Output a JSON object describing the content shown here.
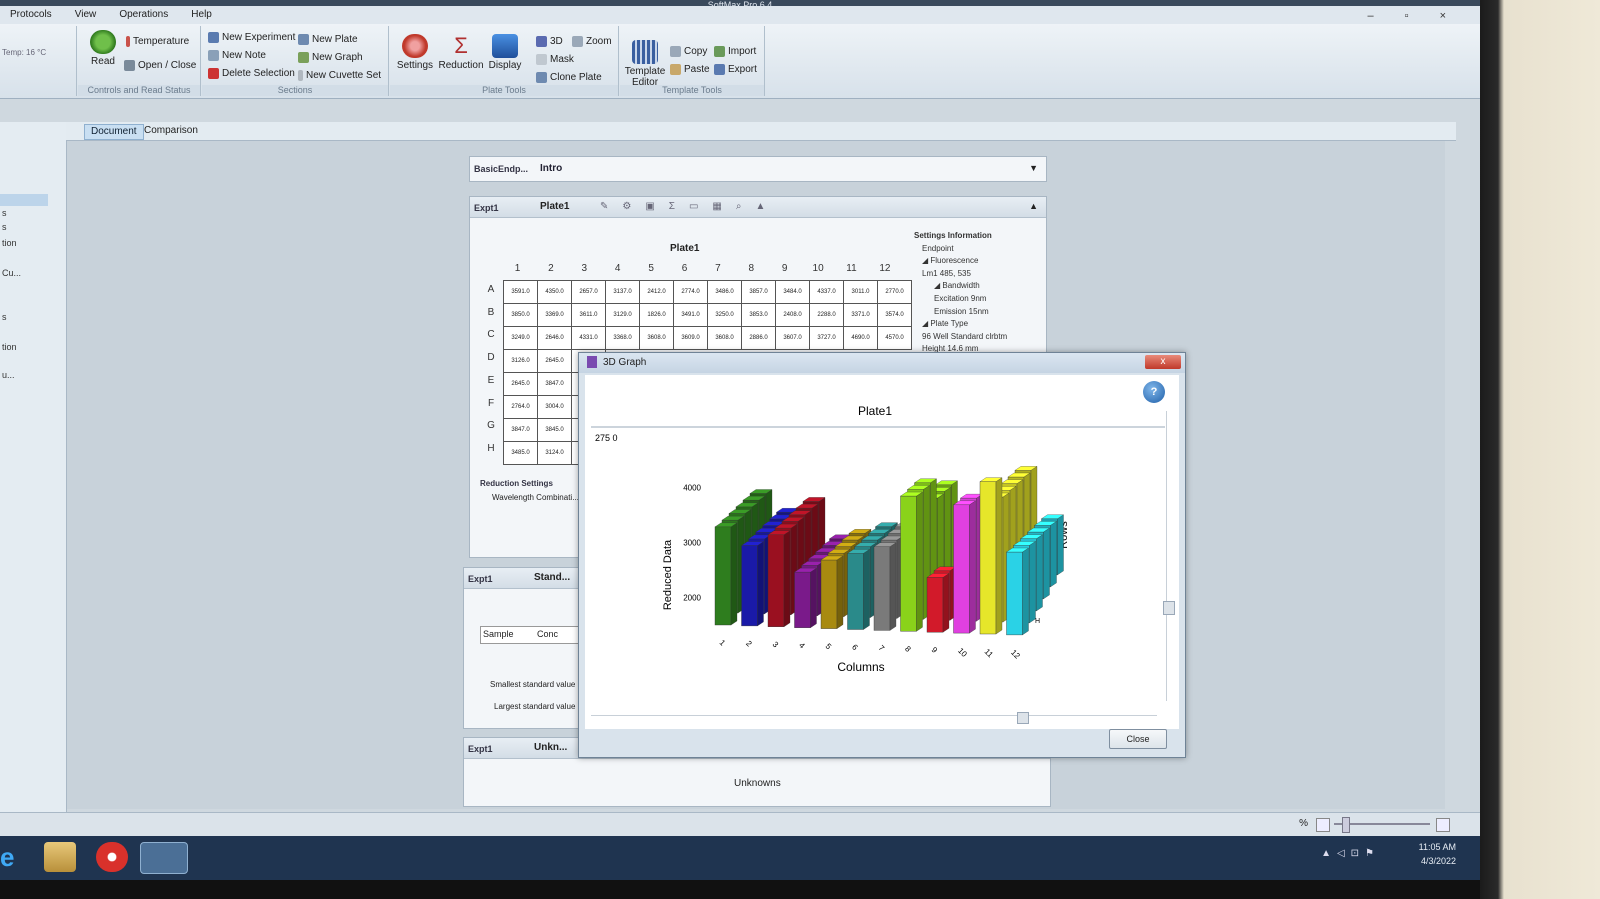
{
  "window": {
    "title": "SoftMax Pro 6.4"
  },
  "menu": [
    "Protocols",
    "View",
    "Operations",
    "Help"
  ],
  "ribbon": {
    "temp_readout": "Temp: 16 °C",
    "controls": {
      "read": "Read",
      "temperature": "Temperature",
      "open_close": "Open / Close",
      "group": "Controls and Read Status"
    },
    "sections": {
      "new_experiment": "New Experiment",
      "new_note": "New Note",
      "delete_selection": "Delete Selection",
      "new_plate": "New Plate",
      "new_graph": "New Graph",
      "new_cuvette_set": "New Cuvette Set",
      "group": "Sections"
    },
    "plate_tools": {
      "settings": "Settings",
      "reduction": "Reduction",
      "display": "Display",
      "three_d": "3D",
      "zoom": "Zoom",
      "mask": "Mask",
      "clone_plate": "Clone Plate",
      "group": "Plate Tools"
    },
    "template_tools": {
      "template_editor": "Template Editor",
      "copy": "Copy",
      "paste": "Paste",
      "import": "Import",
      "export": "Export",
      "group": "Template Tools"
    }
  },
  "doc_tabs": [
    "Document",
    "Comparison"
  ],
  "left_nav": [
    "s",
    "s",
    "tion",
    "Cu...",
    "s",
    "tion",
    "u..."
  ],
  "section_bar": {
    "experiment": "BasicEndp...",
    "title": "Intro"
  },
  "plate_panel": {
    "expt": "Expt1",
    "tab": "Plate1",
    "title": "Plate1",
    "columns": [
      "1",
      "2",
      "3",
      "4",
      "5",
      "6",
      "7",
      "8",
      "9",
      "10",
      "11",
      "12"
    ],
    "rows": [
      "A",
      "B",
      "C",
      "D",
      "E",
      "F",
      "G",
      "H"
    ],
    "values": [
      [
        "3591.0",
        "4350.0",
        "2657.0",
        "3137.0",
        "2412.0",
        "2774.0",
        "3486.0",
        "3857.0",
        "3484.0",
        "4337.0",
        "3011.0",
        "2770.0"
      ],
      [
        "3850.0",
        "3369.0",
        "3611.0",
        "3129.0",
        "1826.0",
        "3491.0",
        "3250.0",
        "3853.0",
        "2408.0",
        "2288.0",
        "3371.0",
        "3574.0"
      ],
      [
        "3249.0",
        "2646.0",
        "4331.0",
        "3368.0",
        "3608.0",
        "3609.0",
        "3608.0",
        "2886.0",
        "3607.0",
        "3727.0",
        "4690.0",
        "4570.0"
      ],
      [
        "3126.0",
        "2645.0"
      ],
      [
        "2645.0",
        "3847.0"
      ],
      [
        "2764.0",
        "3004.0"
      ],
      [
        "3847.0",
        "3845.0"
      ],
      [
        "3485.0",
        "3124.0"
      ]
    ],
    "settings": [
      "Settings Information",
      "Endpoint",
      "◢ Fluorescence",
      "Lm1   485, 535",
      "◢ Bandwidth",
      "Excitation  9nm",
      "Emission  15nm",
      "◢ Plate Type",
      "96 Well Standard clrbtm",
      "Height  14.6 mm"
    ],
    "reduction_title": "Reduction Settings",
    "reduction_line": "Wavelength Combinati..."
  },
  "standard_panel": {
    "expt": "Expt1",
    "tab": "Stand...",
    "cols": [
      "Sample",
      "Conc"
    ],
    "smallest": "Smallest standard value",
    "largest": "Largest standard value"
  },
  "unknown_panel": {
    "expt": "Expt1",
    "tab": "Unkn...",
    "title": "Unknowns"
  },
  "dialog": {
    "title": "3D Graph",
    "close_x": "x",
    "close_button": "Close",
    "help": "?"
  },
  "chart_data": {
    "type": "bar",
    "title": "Plate1",
    "xlabel": "Columns",
    "ylabel": "Reduced Data",
    "zlabel": "Rows",
    "top_label": "275 0",
    "yticks": [
      2000,
      3000,
      4000
    ],
    "categories": [
      "1",
      "2",
      "3",
      "4",
      "5",
      "6",
      "7",
      "8",
      "9",
      "10",
      "11",
      "12"
    ],
    "row_label_front": "H",
    "colors": [
      "#2e7d1e",
      "#1a1aa8",
      "#9a1020",
      "#7a1a8a",
      "#a88a10",
      "#2a8a8a",
      "#7a7a7a",
      "#8ad21a",
      "#d21a2a",
      "#e040e0",
      "#e6e62a",
      "#2ad2e6"
    ],
    "series_values": [
      3485,
      3124,
      3300,
      2600,
      2800,
      2900,
      3000,
      3900,
      2400,
      3700,
      4100,
      3200
    ]
  },
  "status": {
    "zoom_sign": "%"
  },
  "taskbar": {
    "time": "11:05 AM",
    "date": "4/3/2022"
  }
}
